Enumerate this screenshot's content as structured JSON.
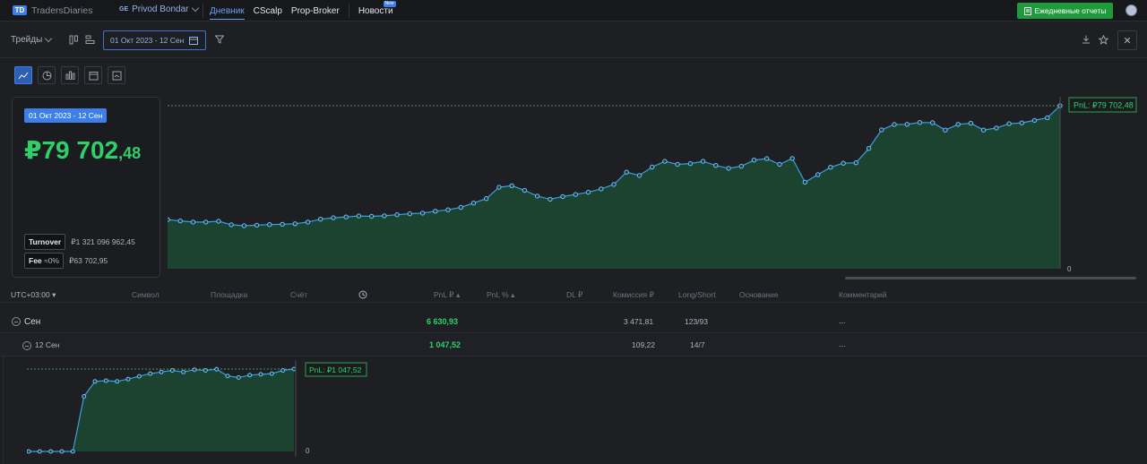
{
  "topbar": {
    "logo_text": "TradersDiaries",
    "logo_mark": "TD",
    "account_tag": "GE",
    "account_name": "Privod Bondar",
    "nav": [
      {
        "label": "Дневник",
        "active": true
      },
      {
        "label": "CScalp",
        "active": false
      },
      {
        "label": "Prop-Broker",
        "active": false
      },
      {
        "label": "Новости",
        "active": false,
        "badge": "New"
      }
    ],
    "daily_reports_label": "Ежедневные отчеты"
  },
  "toolbar": {
    "trades_label": "Трейды",
    "date_range": "01 Окт 2023 - 12 Сен",
    "icons": [
      "columns-icon",
      "rows-icon",
      "calendar-icon",
      "filter-icon",
      "download-icon",
      "star-icon",
      "close-icon"
    ]
  },
  "summary": {
    "range_label": "01 Окт 2023 - 12 Сен",
    "pnl_main": "₽79 702",
    "pnl_cents": ",48",
    "turnover_label": "Turnover",
    "turnover_value": "₽1 321 096 962,45",
    "fee_label": "Fee",
    "fee_pct": "≈0%",
    "fee_value": "₽63 702,95"
  },
  "main_chart": {
    "pnl_tag": "PnL: ₽79 702,48",
    "zero_label": "0"
  },
  "mini_chart": {
    "pnl_tag": "PnL: ₽1 047,52",
    "zero_label": "0"
  },
  "chart_data": [
    {
      "type": "area",
      "values": [
        24000,
        23400,
        22800,
        22800,
        23200,
        21500,
        21000,
        21300,
        21600,
        21700,
        22000,
        22800,
        24200,
        24900,
        25300,
        25800,
        25600,
        25900,
        26400,
        26900,
        27200,
        28100,
        28800,
        30000,
        32100,
        34300,
        39800,
        40600,
        38300,
        35500,
        34000,
        35300,
        36300,
        37400,
        39000,
        41200,
        47200,
        45600,
        49700,
        52500,
        51000,
        51400,
        52500,
        50500,
        49100,
        50100,
        53100,
        53800,
        51000,
        53900,
        42300,
        46000,
        49600,
        51600,
        51800,
        58800,
        67900,
        70500,
        70600,
        71500,
        71400,
        67800,
        70600,
        71100,
        67800,
        68800,
        70900,
        71300,
        72500,
        73800,
        79702.48
      ],
      "ylim": [
        0,
        79702.48
      ]
    },
    {
      "type": "area",
      "values": [
        0,
        0,
        0,
        0,
        0,
        700,
        890,
        900,
        890,
        920,
        955,
        990,
        1010,
        1030,
        1010,
        1040,
        1030,
        1045,
        960,
        940,
        970,
        980,
        990,
        1030,
        1047.52
      ],
      "ylim": [
        0,
        1047.52
      ]
    }
  ],
  "table": {
    "timezone": "UTC+03:00",
    "columns": [
      "Символ",
      "Площадка",
      "Счёт",
      "PnL ₽",
      "PnL %",
      "DL ₽",
      "Комиссия ₽",
      "Long/Short",
      "Основание",
      "Комментарий"
    ],
    "rows": [
      {
        "label": "Сен",
        "pnl": "6 630,93",
        "commission": "3 471,81",
        "long_short": "123/93",
        "comment": "..."
      },
      {
        "label": "12 Сен",
        "pnl": "1 047,52",
        "commission": "109,22",
        "long_short": "14/7",
        "comment": "..."
      }
    ]
  }
}
